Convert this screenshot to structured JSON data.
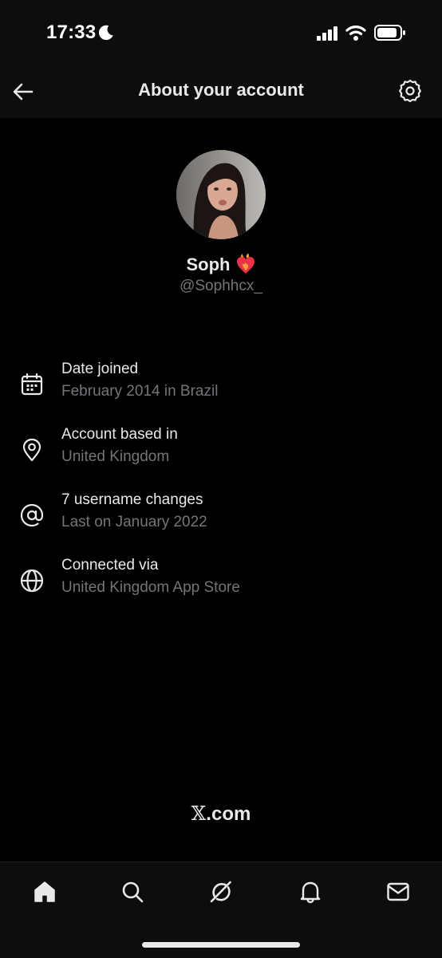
{
  "status_bar": {
    "time": "17:33",
    "icons": [
      "moon-icon",
      "cellular-signal-icon",
      "wifi-icon",
      "battery-icon"
    ]
  },
  "header": {
    "title": "About your account",
    "back_icon": "arrow-left-icon",
    "settings_icon": "gear-icon"
  },
  "profile": {
    "display_name": "Soph",
    "name_emoji_icon": "heart-on-fire-icon",
    "handle": "@Sophhcx_"
  },
  "info_items": [
    {
      "icon": "calendar-icon",
      "title": "Date joined",
      "subtitle": "February 2014 in Brazil"
    },
    {
      "icon": "location-pin-icon",
      "title": "Account based in",
      "subtitle": "United Kingdom"
    },
    {
      "icon": "at-sign-icon",
      "title": "7 username changes",
      "subtitle": "Last on January 2022"
    },
    {
      "icon": "globe-icon",
      "title": "Connected via",
      "subtitle": "United Kingdom App Store"
    }
  ],
  "footer": {
    "brand_x": "𝕏",
    "brand_suffix": ".com"
  },
  "tab_bar": {
    "tabs": [
      "home-icon",
      "search-icon",
      "grok-icon",
      "notifications-bell-icon",
      "messages-envelope-icon"
    ],
    "active": "home-icon"
  },
  "colors": {
    "background": "#000000",
    "primary_text": "#e7e9ea",
    "secondary_text": "#71767b"
  }
}
